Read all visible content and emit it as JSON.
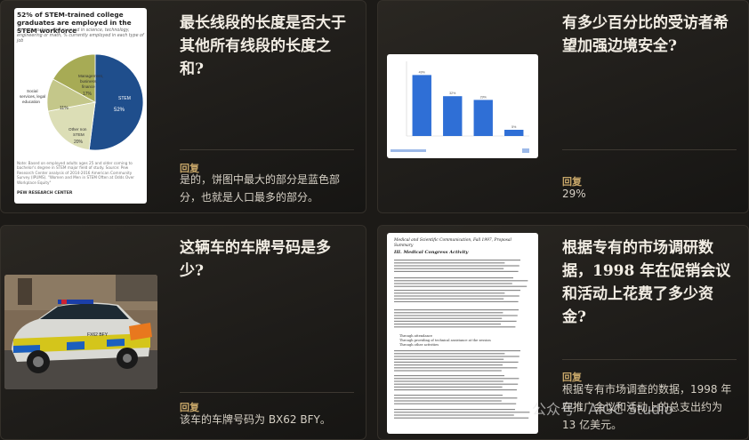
{
  "cards": [
    {
      "question": "最长线段的长度是否大于其他所有线段的长度之和?",
      "reply_label": "回复",
      "answer": "是的，饼图中最大的部分是蓝色部分，也就是人口最多的部分。"
    },
    {
      "question": "有多少百分比的受访者希望加强边境安全?",
      "reply_label": "回复",
      "answer": "29%"
    },
    {
      "question": "这辆车的车牌号码是多少?",
      "reply_label": "回复",
      "answer": "该车的车牌号码为 BX62 BFY。"
    },
    {
      "question": "根据专有的市场调研数据，1998 年在促销会议和活动上花费了多少资金?",
      "reply_label": "回复",
      "answer": "根据专有市场调查的数据，1998 年在推广会议和活动上的总支出约为 13 亿美元。"
    }
  ],
  "pie_thumb": {
    "title": "52% of STEM-trained college graduates are employed in the STEM workforce",
    "subtitle": "Among workers who majored in science, technology, engineering or math, % currently employed in each type of job",
    "note": "Note: Based on employed adults ages 25 and older coming to bachelor's degree in STEM major field of study. Source: Pew Research Center analysis of 2014-2016 American Community Survey (IPUMS). \"Women and Men in STEM Often at Odds Over Workplace Equity\"",
    "source": "PEW RESEARCH CENTER",
    "colors": {
      "stem": "#1f4e8c",
      "mgmt": "#a7ab55",
      "social": "#c4c78a",
      "other": "#dcdeb6"
    },
    "chart_data": {
      "type": "pie",
      "slices": [
        {
          "label": "STEM",
          "value": 52
        },
        {
          "label": "Other non STEM",
          "value": 20
        },
        {
          "label": "Social services, legal education",
          "value": 11
        },
        {
          "label": "Management, business, finance",
          "value": 17
        }
      ]
    }
  },
  "bar_thumb": {
    "colors": {
      "bar": "#2f6fd6"
    },
    "chart_data": {
      "type": "bar",
      "categories": [
        "",
        "",
        "",
        ""
      ],
      "values": [
        49,
        32,
        29,
        5
      ],
      "ylim": [
        0,
        60
      ]
    }
  },
  "car_thumb": {
    "plate": "FX62 BFY"
  },
  "doc_thumb": {
    "heading": "Medical and Scientific Communication, Fall 1997, Proposal Summary",
    "section": "III. Medical Congress Activity",
    "list": [
      "Through attendance",
      "Through providing of technical assistance at the session",
      "Through other activities"
    ]
  },
  "watermark": "公众号 · AIGC Studio"
}
